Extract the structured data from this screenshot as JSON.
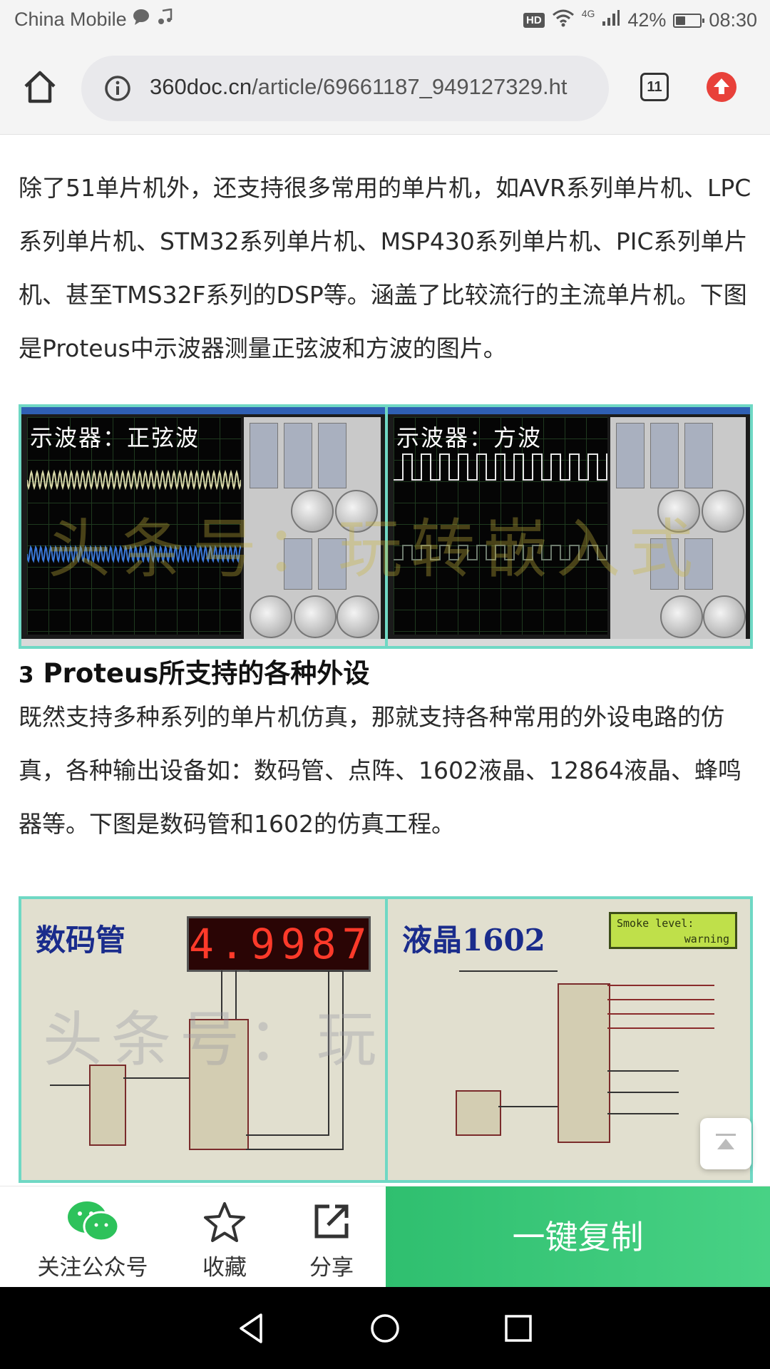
{
  "status_bar": {
    "carrier": "China Mobile",
    "network": "4G",
    "battery": "42%",
    "time": "08:30",
    "battery_level": 0.42
  },
  "browser": {
    "url_domain": "360doc.cn",
    "url_path": "/article/69661187_949127329.ht",
    "tab_count": "11"
  },
  "article": {
    "para1": "除了51单片机外，还支持很多常用的单片机，如AVR系列单片机、LPC系列单片机、STM32系列单片机、MSP430系列单片机、PIC系列单片机、甚至TMS32F系列的DSP等。涵盖了比较流行的主流单片机。下图是Proteus中示波器测量正弦波和方波的图片。",
    "heading_num": "3",
    "heading_text": " Proteus所支持的各种外设",
    "para2": "既然支持多种系列的单片机仿真，那就支持各种常用的外设电路的仿真，各种输出设备如：数码管、点阵、1602液晶、12864液晶、蜂鸣器等。下图是数码管和1602的仿真工程。"
  },
  "figure1": {
    "left_label": "示波器：正弦波",
    "right_label": "示波器：方波",
    "watermark": "头条号：玩转嵌入式"
  },
  "figure2": {
    "left_label": "数码管",
    "display_value": "4.9987",
    "right_label": "液晶1602",
    "lcd_line1": "Smoke level:",
    "lcd_line2": "warning",
    "watermark": "头条号：玩转嵌入式"
  },
  "actions": {
    "follow": "关注公众号",
    "favorite": "收藏",
    "share": "分享",
    "copy": "一键复制"
  },
  "colors": {
    "copy_button": "#3cc878",
    "figure_border": "#6fd8c4",
    "wechat_green": "#2dc25b"
  }
}
